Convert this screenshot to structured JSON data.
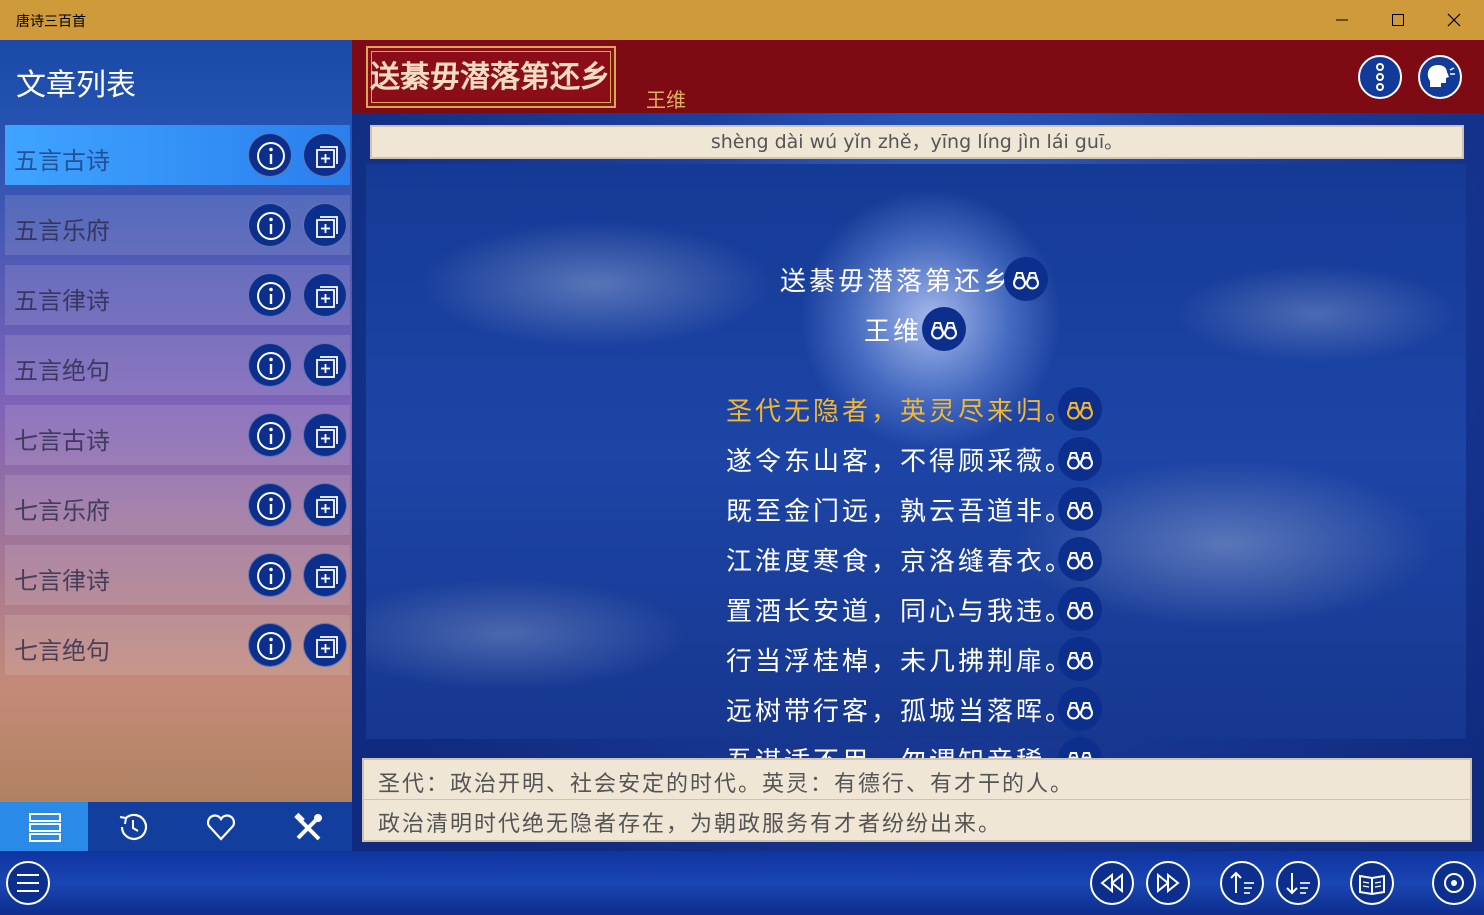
{
  "window": {
    "title": "唐诗三百首"
  },
  "sidebar": {
    "title": "文章列表",
    "categories": [
      {
        "label": "五言古诗"
      },
      {
        "label": "五言乐府"
      },
      {
        "label": "五言律诗"
      },
      {
        "label": "五言绝句"
      },
      {
        "label": "七言古诗"
      },
      {
        "label": "七言乐府"
      },
      {
        "label": "七言律诗"
      },
      {
        "label": "七言绝句"
      }
    ],
    "tabs": [
      {
        "icon": "list-icon",
        "active": true
      },
      {
        "icon": "history-icon",
        "active": false
      },
      {
        "icon": "heart-icon",
        "active": false
      },
      {
        "icon": "tools-icon",
        "active": false
      }
    ]
  },
  "poem": {
    "header_title": "送綦毋潜落第还乡",
    "header_author": "王维",
    "pinyin": "shèng dài wú yǐn zhě，yīng líng jìn lái guī。",
    "title": "送綦毋潜落第还乡",
    "author": "王维",
    "lines": [
      "圣代无隐者，英灵尽来归。",
      "遂令东山客，不得顾采薇。",
      "既至金门远，孰云吾道非。",
      "江淮度寒食，京洛缝春衣。",
      "置酒长安道，同心与我违。",
      "行当浮桂棹，未几拂荆扉。",
      "远树带行客，孤城当落晖。",
      "吾谋适不用，勿谓知音稀。"
    ],
    "highlighted_line": 0,
    "notes": [
      "圣代：政治开明、社会安定的时代。英灵：有德行、有才干的人。",
      "政治清明时代绝无隐者存在，为朝政服务有才者纷纷出来。"
    ]
  },
  "colors": {
    "titlebar": "#cf9a3a",
    "header_red": "#7e0b14",
    "highlight": "#f2b72e",
    "button_blue": "#0c2f8e",
    "active_tab": "#2a8ae8"
  }
}
